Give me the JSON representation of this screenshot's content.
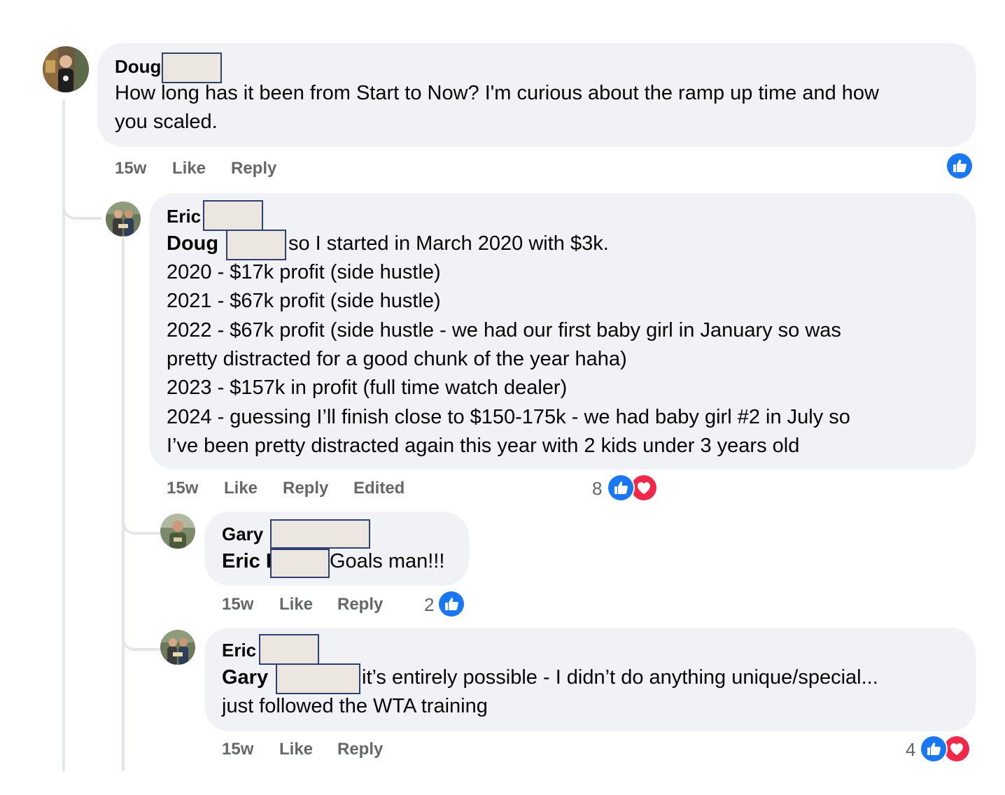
{
  "comments": [
    {
      "author": "Doug",
      "lines": [
        "How long has it been from Start to Now? I'm curious about the ramp up time and how",
        "you scaled."
      ],
      "time": "15w",
      "like_label": "Like",
      "reply_label": "Reply",
      "reaction_count": "",
      "reactions": [
        "like-icon"
      ]
    },
    {
      "author": "Eric",
      "mention": "Doug",
      "first_line": "so I started in March 2020 with $3k.",
      "lines": [
        "2020 - $17k profit (side hustle)",
        "2021 - $67k profit (side hustle)",
        "2022 - $67k profit (side hustle - we had our first baby girl in January so was",
        "pretty distracted for a good chunk of the year haha)",
        "2023 - $157k in profit (full time watch dealer)",
        "2024 - guessing I’ll finish close to $150-175k - we had baby girl #2 in July so",
        "I’ve been pretty distracted again this year with 2 kids under 3 years old"
      ],
      "time": "15w",
      "like_label": "Like",
      "reply_label": "Reply",
      "edited_label": "Edited",
      "reaction_count": "8",
      "reactions": [
        "like-icon",
        "love-icon"
      ]
    },
    {
      "author": "Gary",
      "mention": "Eric I",
      "first_line": "Goals man!!!",
      "time": "15w",
      "like_label": "Like",
      "reply_label": "Reply",
      "reaction_count": "2",
      "reactions": [
        "like-icon"
      ]
    },
    {
      "author": "Eric",
      "mention": "Gary",
      "first_line": "it’s entirely possible - I didn’t do anything unique/special...",
      "lines": [
        "just followed the WTA training"
      ],
      "time": "15w",
      "like_label": "Like",
      "reply_label": "Reply",
      "reaction_count": "4",
      "reactions": [
        "like-icon",
        "love-icon"
      ]
    }
  ],
  "colors": {
    "bubble": "#f0f2f5",
    "meta_text": "#65676b",
    "like_blue": "#1877f2",
    "love_red": "#f0284a",
    "thread_line": "#e4e6eb",
    "redaction_fill": "#ebe7e0",
    "redaction_border": "#2d3f73"
  }
}
